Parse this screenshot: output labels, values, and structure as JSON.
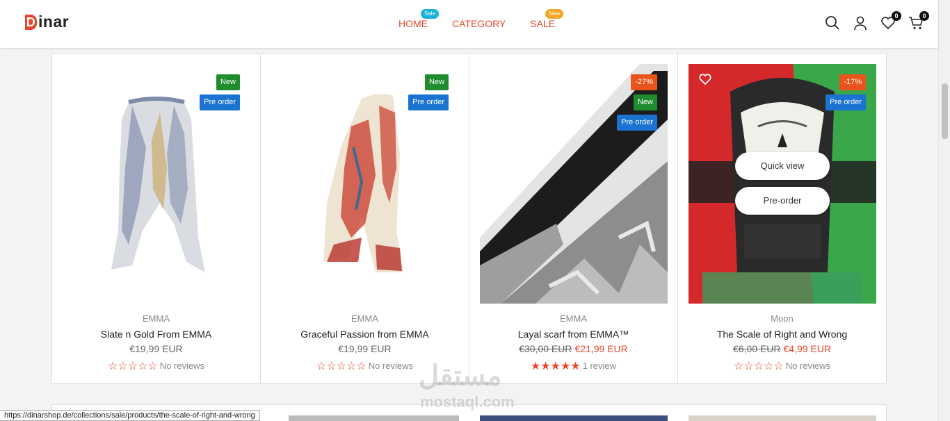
{
  "header": {
    "logo_text": "inar",
    "logo_mark": "D",
    "nav": [
      {
        "label": "HOME",
        "tag": "Sale"
      },
      {
        "label": "CATEGORY"
      },
      {
        "label": "SALE",
        "tag": "New"
      }
    ],
    "wishlist_count": "0",
    "cart_count": "0"
  },
  "products": [
    {
      "vendor": "EMMA",
      "title": "Slate n Gold From EMMA",
      "price": "€19,99 EUR",
      "rating": "☆☆☆☆☆",
      "reviews": "No reviews",
      "labels": [
        "New",
        "Pre order"
      ]
    },
    {
      "vendor": "EMMA",
      "title": "Graceful Passion from EMMA",
      "price": "€19,99 EUR",
      "rating": "☆☆☆☆☆",
      "reviews": "No reviews",
      "labels": [
        "New",
        "Pre order"
      ]
    },
    {
      "vendor": "EMMA",
      "title": "Layal scarf from EMMA™",
      "compare_price": "€30,00 EUR",
      "price": "€21,99 EUR",
      "rating": "★★★★★",
      "reviews": "1 review",
      "labels": [
        "-27%",
        "New",
        "Pre order"
      ]
    },
    {
      "vendor": "Moon",
      "title": "The Scale of Right and Wrong",
      "compare_price": "€6,00 EUR",
      "price": "€4,99 EUR",
      "rating": "☆☆☆☆☆",
      "reviews": "No reviews",
      "labels": [
        "-17%",
        "Pre order"
      ],
      "quick_view": "Quick view",
      "pre_order_btn": "Pre-order"
    }
  ],
  "status_url": "https://dinarshop.de/collections/sale/products/the-scale-of-right-and-wrong",
  "watermark": {
    "arabic": "مستقل",
    "latin": "mostaql.com"
  },
  "colors": {
    "accent": "#e8462b",
    "new": "#1f8c2e",
    "pre_order": "#1a73d1",
    "discount": "#e8541b"
  }
}
